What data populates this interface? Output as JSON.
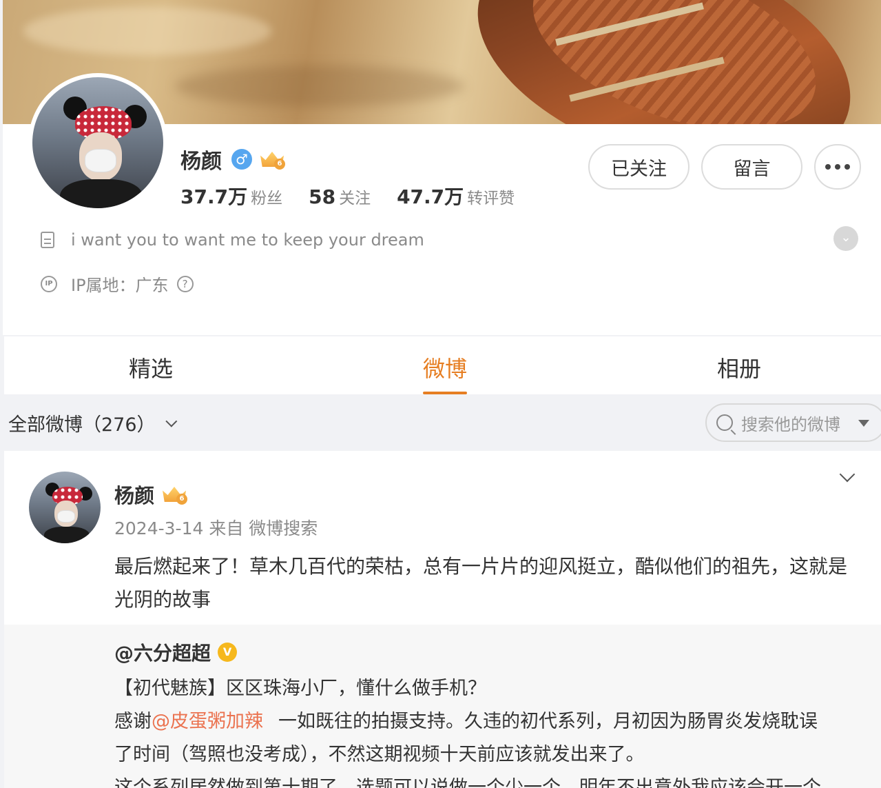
{
  "profile": {
    "name": "杨颜",
    "gender_symbol": "♂",
    "vip_level": "6",
    "stats": [
      {
        "num": "37.7万",
        "label": "粉丝"
      },
      {
        "num": "58",
        "label": "关注"
      },
      {
        "num": "47.7万",
        "label": "转评赞"
      }
    ],
    "buttons": {
      "follow": "已关注",
      "message": "留言"
    },
    "description": "i want you to want me to keep your dream",
    "ip_location": "IP属地：广东",
    "ip_icon_text": "IP",
    "help_symbol": "?",
    "expand_symbol": "⌄"
  },
  "tabs": [
    {
      "label": "精选"
    },
    {
      "label": "微博",
      "active": true
    },
    {
      "label": "相册"
    }
  ],
  "filter": {
    "label": "全部微博（276）",
    "search_placeholder": "搜索他的微博"
  },
  "post": {
    "author": "杨颜",
    "vip_level": "6",
    "meta": "2024-3-14 来自 微博搜索",
    "text": "最后燃起来了！草木几百代的荣枯，总有一片片的迎风挺立，酷似他们的祖先，这就是光阴的故事",
    "retweet": {
      "author": "@六分超超",
      "verified_symbol": "V",
      "line1": "【初代魅族】区区珠海小厂，懂什么做手机？",
      "line2_prefix": "感谢",
      "line2_mention": "@皮蛋粥加辣",
      "line2_rest": "一如既往的拍摄支持。久违的初代系列，月初因为肠胃炎发烧耽误",
      "line3": "了时间（驾照也没考成），不然这期视频十天前应该就发出来了。",
      "line4": "这个系列居然做到第十期了，选题可以说做一个少一个，明年不出意外我应该会开一个"
    }
  },
  "colors": {
    "accent": "#e67e22",
    "mention": "#eb7350",
    "gender_badge": "#56a6ef",
    "verified_badge": "#f6b81d"
  },
  "icons": [
    "document-icon",
    "ip-icon",
    "help-icon",
    "expand-icon",
    "search-icon",
    "more-icon",
    "chevron-down-icon",
    "gender-icon",
    "vip-crown-icon",
    "verified-icon"
  ]
}
